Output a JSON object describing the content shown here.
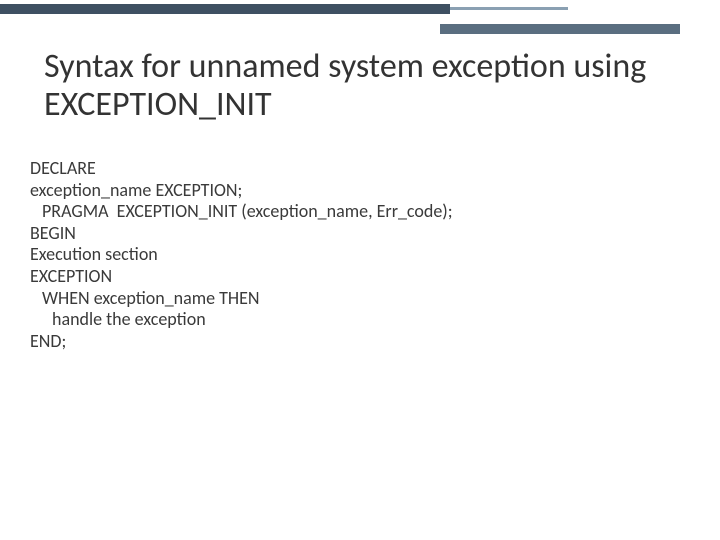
{
  "title": "Syntax for unnamed system exception using EXCEPTION_INIT",
  "code": {
    "l1": "DECLARE",
    "l2": "exception_name EXCEPTION;",
    "l3": "PRAGMA  EXCEPTION_INIT (exception_name, Err_code);",
    "l4": "BEGIN",
    "l5": "Execution section",
    "l6": "EXCEPTION",
    "l7": "WHEN exception_name THEN",
    "l8": "handle the exception",
    "l9": "END;"
  }
}
